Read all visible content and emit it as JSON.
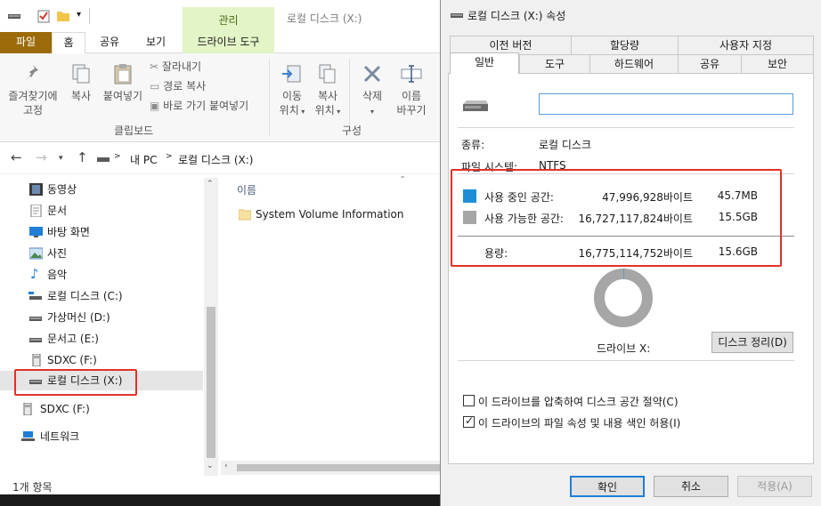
{
  "explorer": {
    "context_tab_group": "관리",
    "window_title": "로컬 디스크 (X:)",
    "tabs": {
      "file": "파일",
      "home": "홈",
      "share": "공유",
      "view": "보기",
      "drive_tools": "드라이브 도구"
    },
    "ribbon": {
      "pin_quick_access": [
        "즐겨찾기에",
        "고정"
      ],
      "copy": "복사",
      "paste": "붙여넣기",
      "cut": "잘라내기",
      "copy_path": "경로 복사",
      "paste_shortcut": "바로 가기 붙여넣기",
      "clipboard_group": "클립보드",
      "move_to": [
        "이동",
        "위치"
      ],
      "copy_to": [
        "복사",
        "위치"
      ],
      "delete": "삭제",
      "rename": [
        "이름",
        "바꾸기"
      ],
      "organize_group": "구성"
    },
    "address": {
      "path": [
        "내 PC",
        "로컬 디스크 (X:)"
      ],
      "separator": ">"
    },
    "nav_items": [
      {
        "label": "동영상",
        "icon": "video-icon"
      },
      {
        "label": "문서",
        "icon": "document-icon"
      },
      {
        "label": "바탕 화면",
        "icon": "desktop-icon"
      },
      {
        "label": "사진",
        "icon": "picture-icon"
      },
      {
        "label": "음악",
        "icon": "music-icon"
      },
      {
        "label": "로컬 디스크 (C:)",
        "icon": "system-drive-icon"
      },
      {
        "label": "가상머신 (D:)",
        "icon": "drive-icon"
      },
      {
        "label": "문서고 (E:)",
        "icon": "drive-icon"
      },
      {
        "label": "SDXC (F:)",
        "icon": "sd-card-icon"
      },
      {
        "label": "로컬 디스크 (X:)",
        "icon": "drive-icon",
        "selected": true
      },
      {
        "label": "SDXC (F:)",
        "icon": "sd-card-icon"
      },
      {
        "label": "네트워크",
        "icon": "network-icon"
      }
    ],
    "column_header": "이름",
    "files": [
      {
        "name": "System Volume Information",
        "icon": "folder-icon"
      }
    ],
    "status": "1개 항목"
  },
  "dialog": {
    "title": "로컬 디스크 (X:) 속성",
    "tabs_row1": [
      "이전 버전",
      "할당량",
      "사용자 지정"
    ],
    "tabs_row2": [
      "일반",
      "도구",
      "하드웨어",
      "공유",
      "보안"
    ],
    "active_tab": "일반",
    "volume_label_value": "",
    "type_label": "종류:",
    "type_value": "로컬 디스크",
    "fs_label": "파일 시스템:",
    "fs_value": "NTFS",
    "used": {
      "label": "사용 중인 공간:",
      "bytes": "47,996,928바이트",
      "size": "45.7MB",
      "color": "#1e8fd6"
    },
    "free": {
      "label": "사용 가능한 공간:",
      "bytes": "16,727,117,824바이트",
      "size": "15.5GB",
      "color": "#a6a6a6"
    },
    "capacity": {
      "label": "용량:",
      "bytes": "16,775,114,752바이트",
      "size": "15.6GB"
    },
    "usage_fraction": 0.003,
    "drive_label": "드라이브 X:",
    "cleanup_button": "디스크 정리(D)",
    "compress_checkbox": {
      "label": "이 드라이브를 압축하여 디스크 공간 절약(C)",
      "checked": false
    },
    "index_checkbox": {
      "label": "이 드라이브의 파일 속성 및 내용 색인 허용(I)",
      "checked": true
    },
    "ok_button": "확인",
    "cancel_button": "취소",
    "apply_button": "적용(A)"
  }
}
